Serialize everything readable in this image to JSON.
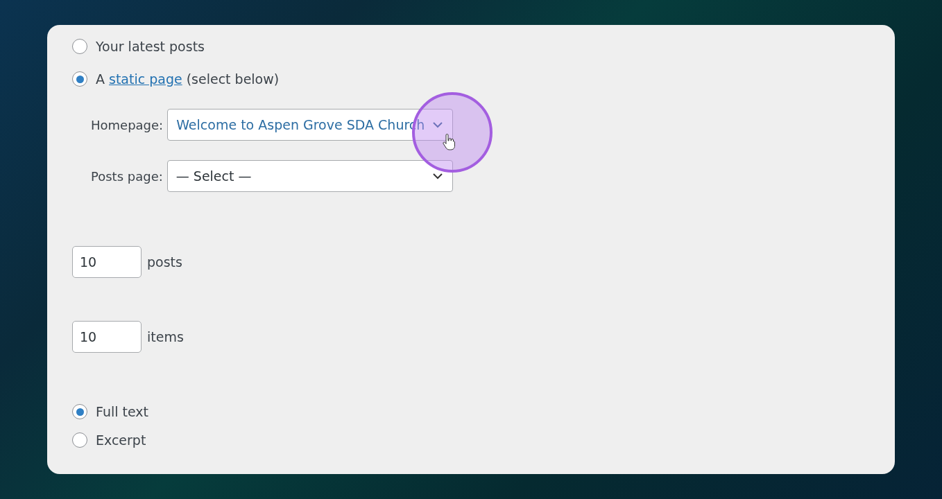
{
  "front_page": {
    "options": [
      {
        "kind": "text",
        "label": "Your latest posts",
        "selected": false
      },
      {
        "kind": "link",
        "prefix": "A",
        "link": "static page",
        "suffix": "(select below)",
        "selected": true
      }
    ]
  },
  "page_selects": [
    {
      "label": "Homepage:",
      "value": "Welcome to Aspen Grove SDA Church",
      "hovered": true
    },
    {
      "label": "Posts page:",
      "value": "— Select —",
      "hovered": false
    }
  ],
  "number_fields": [
    {
      "value": "10",
      "unit": "posts"
    },
    {
      "value": "10",
      "unit": "items"
    }
  ],
  "feed_options": [
    {
      "label": "Full text",
      "selected": true
    },
    {
      "label": "Excerpt",
      "selected": false
    }
  ]
}
